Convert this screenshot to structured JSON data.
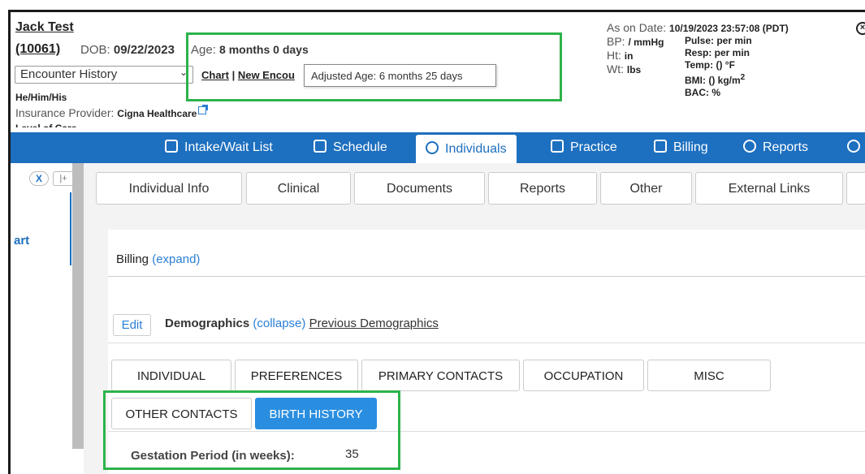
{
  "patient": {
    "name": "Jack Test",
    "id": "(10061)",
    "dob_label": "DOB:",
    "dob_value": "09/22/2023",
    "age_label": "Age:",
    "age_value": "8 months 0 days",
    "encounter_select": "Encounter History",
    "chart_link": "Chart",
    "new_encounter_link": "New Encou",
    "adjusted_age_tooltip": "Adjusted Age: 6 months 25 days",
    "pronouns": "He/Him/His",
    "insurance_label": "Insurance Provider:",
    "insurance_value": "Cigna Healthcare",
    "cut_line": "Level of Care"
  },
  "vitals": {
    "as_on_label": "As on Date:",
    "as_on_value": "10/19/2023 23:57:08 (PDT)",
    "bp_label": "BP:",
    "bp_value": "/ mmHg",
    "ht_label": "Ht:",
    "ht_value": "in",
    "wt_label": "Wt:",
    "wt_value": "lbs",
    "pulse": "Pulse: per min",
    "resp": "Resp: per min",
    "temp": "Temp: () °F",
    "bmi": "BMI: () kg/m",
    "bmi_sup": "2",
    "bac": "BAC: %"
  },
  "nav": {
    "items": [
      {
        "label": "Intake/Wait List",
        "icon": "intake-icon"
      },
      {
        "label": "Schedule",
        "icon": "calendar-icon"
      },
      {
        "label": "Individuals",
        "icon": "person-icon"
      },
      {
        "label": "Practice",
        "icon": "practice-icon"
      },
      {
        "label": "Billing",
        "icon": "billing-icon"
      },
      {
        "label": "Reports",
        "icon": "reports-icon"
      }
    ],
    "active": "Individuals"
  },
  "sidebar": {
    "close_label": "X",
    "pin_label": "|+",
    "item_label": "art"
  },
  "tabs": [
    "Individual Info",
    "Clinical",
    "Documents",
    "Reports",
    "Other",
    "External Links"
  ],
  "billing": {
    "label": "Billing",
    "toggle": "(expand)"
  },
  "demographics": {
    "edit_label": "Edit",
    "label": "Demographics",
    "toggle": "(collapse)",
    "previous_link": "Previous Demographics"
  },
  "sub_tabs": {
    "row1": [
      "INDIVIDUAL",
      "PREFERENCES",
      "PRIMARY CONTACTS",
      "OCCUPATION",
      "MISC"
    ],
    "row2": [
      "OTHER CONTACTS",
      "BIRTH HISTORY"
    ],
    "active": "BIRTH HISTORY"
  },
  "birth_history": {
    "gestation_label": "Gestation Period (in weeks):",
    "gestation_value": "35"
  },
  "colors": {
    "nav_blue": "#1d6fbf",
    "highlight_green": "#2db34a",
    "active_tab_blue": "#2a8ee0"
  }
}
